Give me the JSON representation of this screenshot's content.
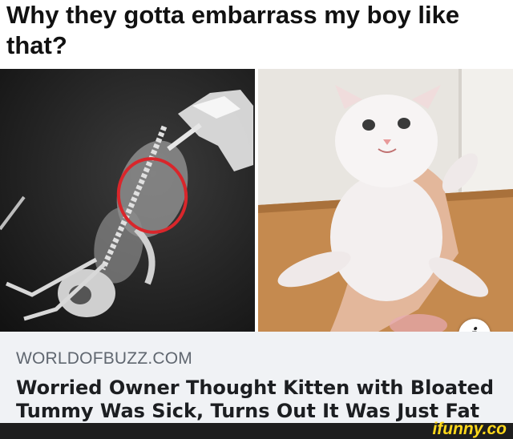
{
  "post": {
    "caption": "Why they gotta embarrass my boy like that?"
  },
  "link_preview": {
    "source": "WORLDOFBUZZ.COM",
    "headline": "Worried Owner Thought Kitten with Bloated Tummy Was Sick, Turns Out It Was Just Fat",
    "info_icon": "info-icon",
    "info_glyph": "i"
  },
  "images": {
    "left": "xray-image",
    "right": "kitten-image",
    "highlight_color": "#d9262b"
  },
  "watermark": {
    "text": "ifunny.co",
    "color": "#ffd81a"
  }
}
